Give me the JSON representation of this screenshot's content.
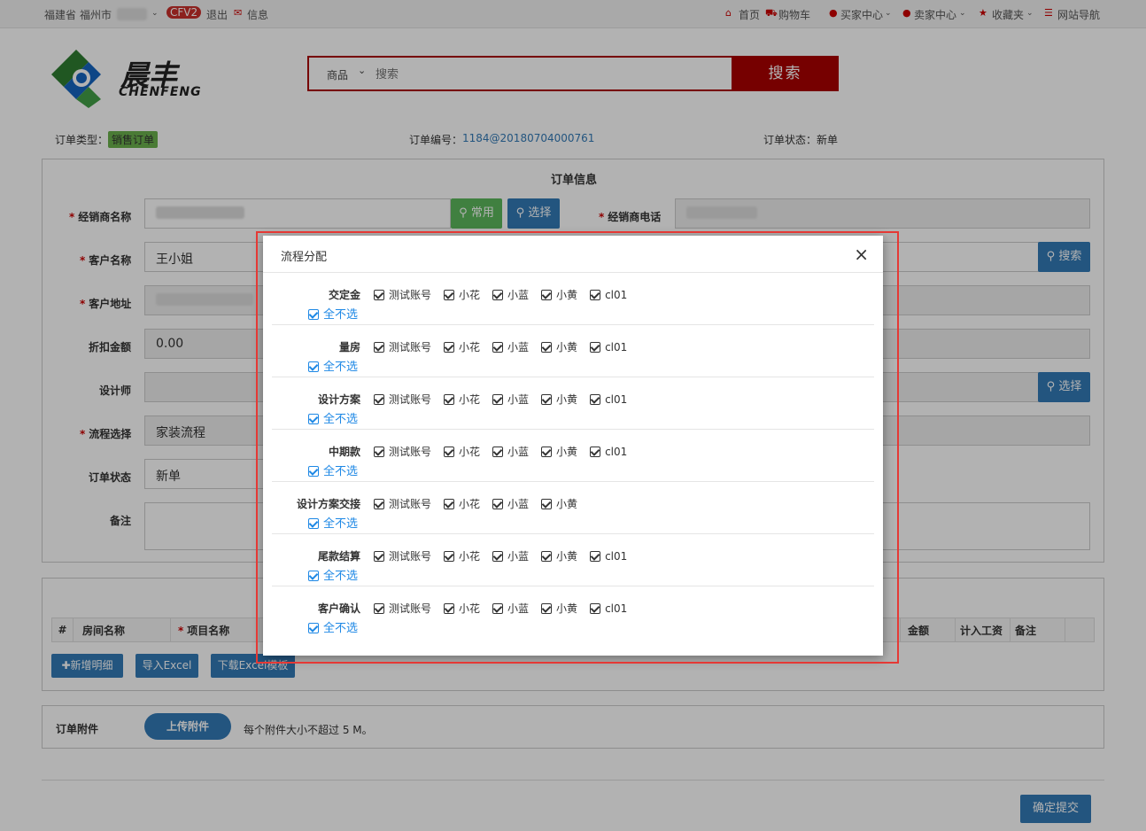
{
  "topbar": {
    "province": "福建省",
    "city": "福州市",
    "cfv": "CFV2",
    "logout": "退出",
    "messages": "信息",
    "home": "首页",
    "cart": "购物车",
    "buyer_center": "买家中心",
    "seller_center": "卖家中心",
    "favorites": "收藏夹",
    "site_nav": "网站导航"
  },
  "logo": {
    "cn": "晨丰",
    "en": "CHENFENG"
  },
  "search": {
    "category": "商品",
    "placeholder": "搜索",
    "button": "搜索"
  },
  "order_meta": {
    "type_label": "订单类型：",
    "type_value": "销售订单",
    "number_label": "订单编号：",
    "number_value": "1184@20180704000761",
    "status_label": "订单状态：",
    "status_value": "新单"
  },
  "order_info": {
    "title": "订单信息",
    "dealer_name_label": "经销商名称",
    "common_btn": "常用",
    "select_btn": "选择",
    "dealer_phone_label": "经销商电话",
    "customer_name_label": "客户名称",
    "customer_name_value": "王小姐",
    "search_btn": "搜索",
    "customer_addr_label": "客户地址",
    "discount_label": "折扣金额",
    "discount_value": "0.00",
    "designer_label": "设计师",
    "designer_select_btn": "选择",
    "flow_label": "流程选择",
    "flow_value": "家装流程",
    "status_label": "订单状态",
    "status_value": "新单",
    "remark_label": "备注"
  },
  "detail_table": {
    "headers": [
      "#",
      "房间名称",
      "项目名称",
      "金额",
      "计入工资",
      "备注"
    ],
    "add_btn": "新增明细",
    "import_btn": "导入Excel",
    "download_btn": "下载Excel模板"
  },
  "attachment": {
    "label": "订单附件",
    "upload_btn": "上传附件",
    "hint": "每个附件大小不超过 5 M。"
  },
  "submit_btn": "确定提交",
  "modal": {
    "title": "流程分配",
    "close": "×",
    "unselect_label": "全不选",
    "rows": [
      {
        "name": "交定金",
        "options": [
          "测试账号",
          "小花",
          "小蓝",
          "小黄",
          "cl01"
        ]
      },
      {
        "name": "量房",
        "options": [
          "测试账号",
          "小花",
          "小蓝",
          "小黄",
          "cl01"
        ]
      },
      {
        "name": "设计方案",
        "options": [
          "测试账号",
          "小花",
          "小蓝",
          "小黄",
          "cl01"
        ]
      },
      {
        "name": "中期款",
        "options": [
          "测试账号",
          "小花",
          "小蓝",
          "小黄",
          "cl01"
        ]
      },
      {
        "name": "设计方案交接",
        "options": [
          "测试账号",
          "小花",
          "小蓝",
          "小黄"
        ]
      },
      {
        "name": "尾款结算",
        "options": [
          "测试账号",
          "小花",
          "小蓝",
          "小黄",
          "cl01"
        ]
      },
      {
        "name": "客户确认",
        "options": [
          "测试账号",
          "小花",
          "小蓝",
          "小黄",
          "cl01"
        ]
      }
    ]
  },
  "colors": {
    "brand_red": "#aa0000",
    "primary_blue": "#337ab7",
    "link_blue": "#1e88e5",
    "highlight": "#e53935"
  }
}
